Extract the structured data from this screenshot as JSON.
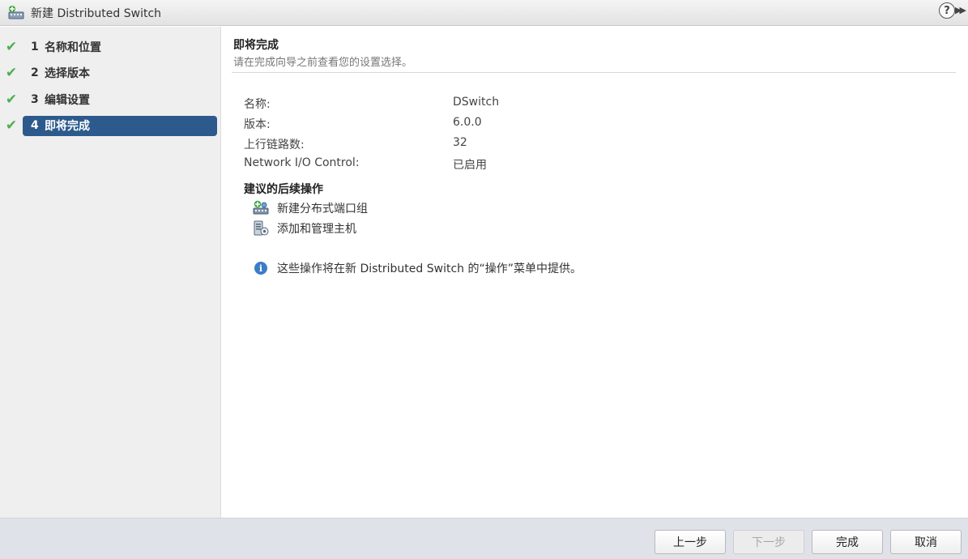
{
  "window": {
    "title": "新建 Distributed Switch",
    "help_label": "?",
    "expand_label": "▶▶"
  },
  "steps": [
    {
      "num": "1",
      "label": "名称和位置",
      "done": true,
      "active": false
    },
    {
      "num": "2",
      "label": "选择版本",
      "done": true,
      "active": false
    },
    {
      "num": "3",
      "label": "编辑设置",
      "done": true,
      "active": false
    },
    {
      "num": "4",
      "label": "即将完成",
      "done": true,
      "active": true
    }
  ],
  "main": {
    "title": "即将完成",
    "subtitle": "请在完成向导之前查看您的设置选择。",
    "summary": [
      {
        "label": "名称:",
        "value": "DSwitch"
      },
      {
        "label": "版本:",
        "value": "6.0.0"
      },
      {
        "label": "上行链路数:",
        "value": "32"
      },
      {
        "label": "Network I/O Control:",
        "value": "已启用"
      }
    ],
    "next_steps_title": "建议的后续操作",
    "actions": [
      {
        "label": "新建分布式端口组",
        "icon": "portgroup-add-icon"
      },
      {
        "label": "添加和管理主机",
        "icon": "host-manage-icon"
      }
    ],
    "info_text": "这些操作将在新 Distributed Switch 的“操作”菜单中提供。"
  },
  "footer": {
    "back": "上一步",
    "next": "下一步",
    "finish": "完成",
    "cancel": "取消"
  },
  "colors": {
    "active_step": "#2d5a8c",
    "check": "#4caf50",
    "info": "#3b7dc8"
  }
}
